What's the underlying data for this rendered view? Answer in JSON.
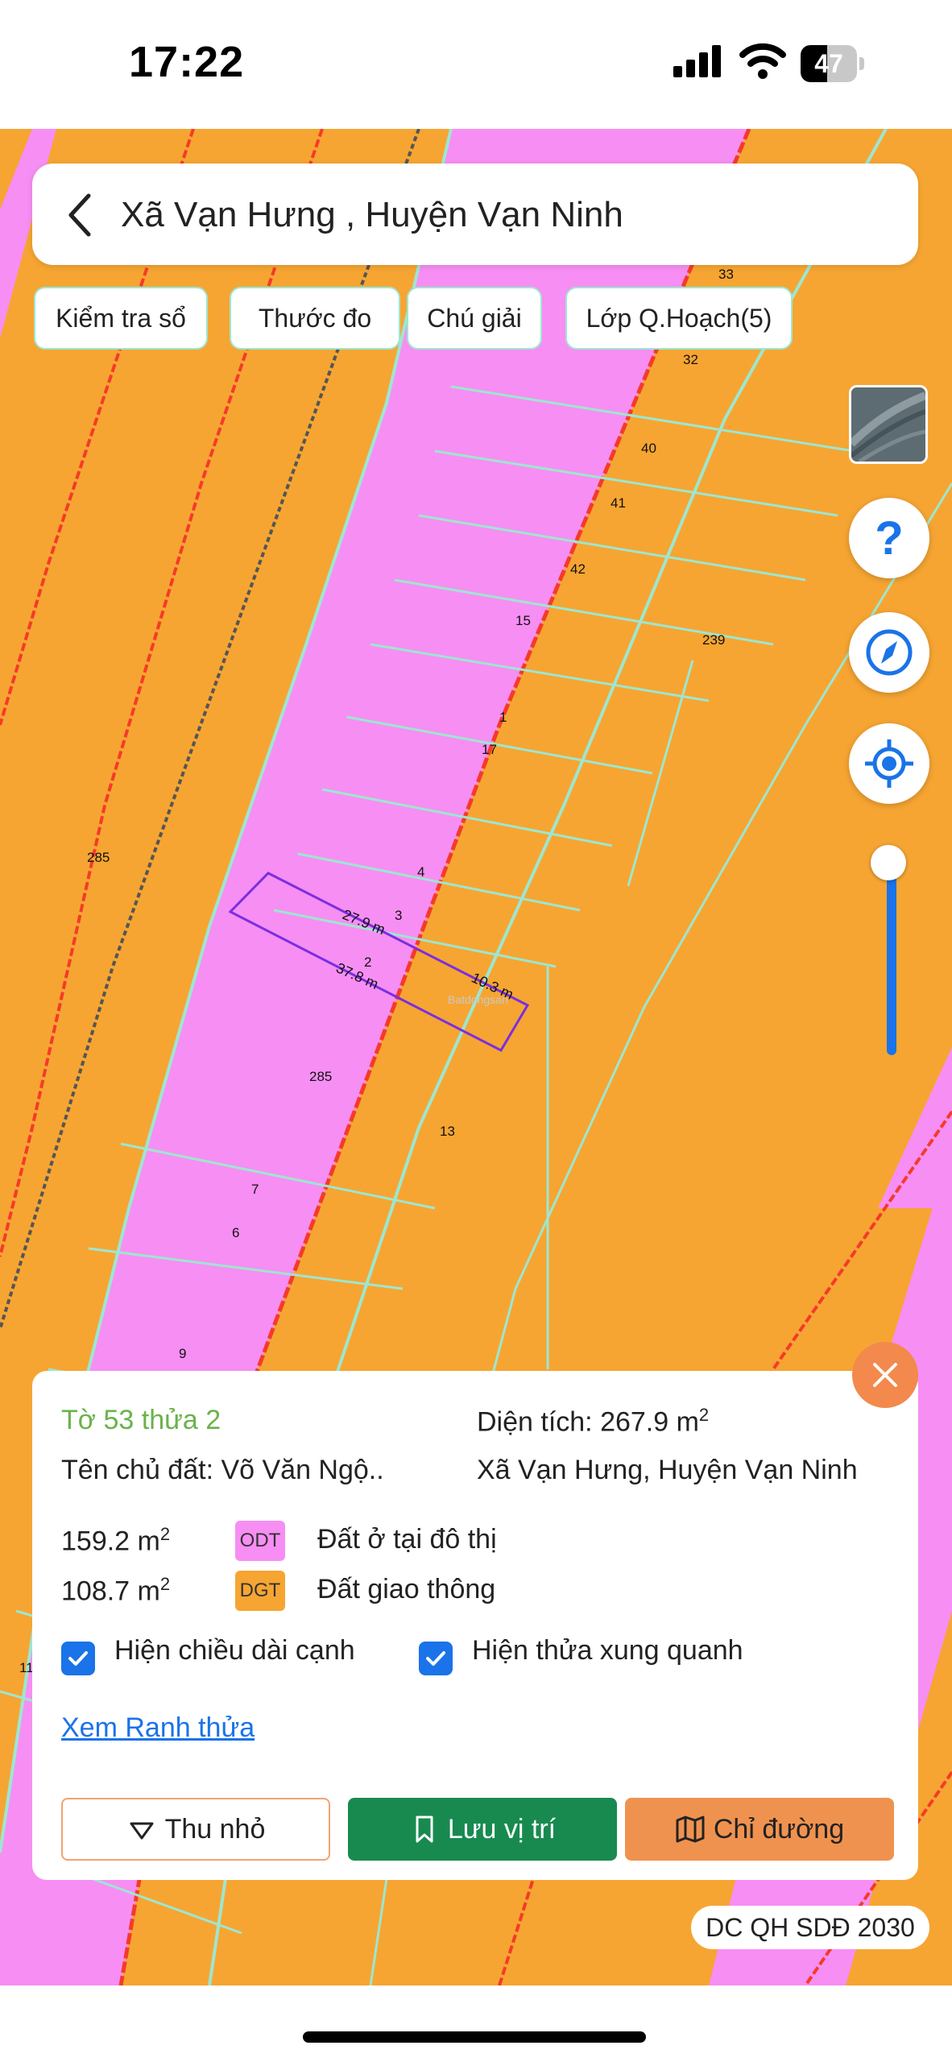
{
  "status_bar": {
    "time": "17:22",
    "battery": "47",
    "battery_fraction": 0.47
  },
  "header": {
    "title": "Xã Vạn Hưng , Huyện Vạn Ninh"
  },
  "toolbar": {
    "chips": [
      "Kiểm tra sổ",
      "Thước đo",
      "Chú giải",
      "Lớp Q.Hoạch(5)"
    ]
  },
  "map": {
    "plot_numbers": [
      "33",
      "32",
      "40",
      "41",
      "42",
      "15",
      "239",
      "1",
      "17",
      "4",
      "3",
      "2",
      "285",
      "285",
      "13",
      "7",
      "6",
      "9",
      "11"
    ],
    "dimensions": [
      "27.9 m",
      "37.8 m",
      "10.3 m"
    ],
    "watermark": "Batdongsan",
    "colors": {
      "residential": "#f78ef3",
      "transport": "#f6a532",
      "boundary_red": "#f53a2a",
      "parcel_lines": "#9ee6d0",
      "selected": "#7a2fe0"
    }
  },
  "controls": {
    "icons": [
      "satellite-thumbnail",
      "help-icon",
      "compass-icon",
      "locate-icon"
    ],
    "zoom_level_fraction": 0.95
  },
  "panel": {
    "plot_id": "Tờ 53 thửa 2",
    "area_prefix": "Diện tích: 267.9 m",
    "area_sup": "2",
    "owner": "Tên chủ đất: Võ Văn Ngộ..",
    "address": "Xã Vạn Hưng, Huyện Vạn Ninh",
    "land_uses": [
      {
        "area": "159.2 m",
        "sup": "2",
        "code": "ODT",
        "name": "Đất ở tại đô thị",
        "color": "#f78ef3"
      },
      {
        "area": "108.7 m",
        "sup": "2",
        "code": "DGT",
        "name": "Đất giao thông",
        "color": "#f6a532"
      }
    ],
    "show_edge_lengths": "Hiện chiều dài cạnh",
    "show_neighbors": "Hiện thửa xung quanh",
    "view_boundary": "Xem Ranh thửa",
    "collapse": "Thu nhỏ",
    "save_location": "Lưu vị trí",
    "directions": "Chỉ đường"
  },
  "layer_label": "DC QH SDĐ 2030"
}
